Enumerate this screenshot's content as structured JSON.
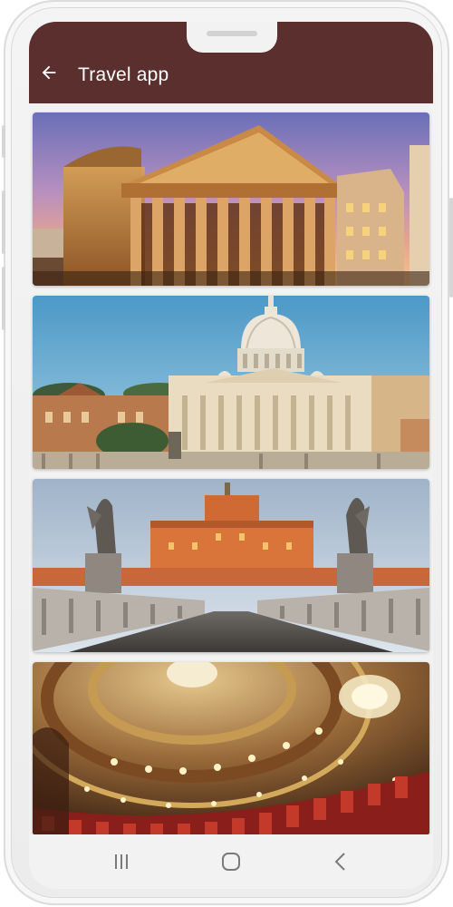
{
  "app": {
    "title": "Travel app"
  },
  "icons": {
    "back": "arrow-left-icon",
    "recents": "recents-icon",
    "home": "home-icon",
    "system_back": "chevron-left-icon"
  },
  "colors": {
    "appbar": "#5a2f2e",
    "title_text": "#ffffff",
    "background": "#f2f2f2",
    "nav_icons": "#7a7a7a"
  },
  "places": [
    {
      "image": "pantheon-image"
    },
    {
      "image": "st-peters-basilica-image"
    },
    {
      "image": "castel-sant-angelo-image"
    },
    {
      "image": "theater-dome-interior-image"
    }
  ]
}
